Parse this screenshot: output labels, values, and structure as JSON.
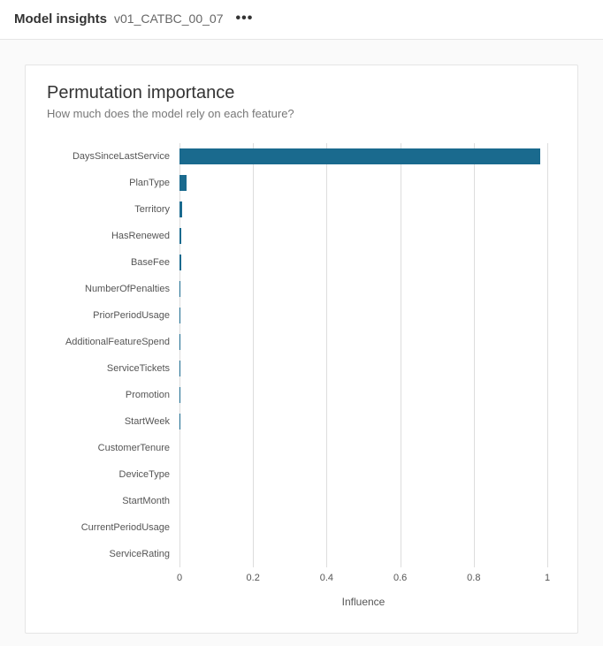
{
  "header": {
    "title": "Model insights",
    "subtitle": "v01_CATBC_00_07"
  },
  "card": {
    "title": "Permutation importance",
    "subtitle": "How much does the model rely on each feature?"
  },
  "chart_data": {
    "type": "bar",
    "orientation": "horizontal",
    "categories": [
      "DaysSinceLastService",
      "PlanType",
      "Territory",
      "HasRenewed",
      "BaseFee",
      "NumberOfPenalties",
      "PriorPeriodUsage",
      "AdditionalFeatureSpend",
      "ServiceTickets",
      "Promotion",
      "StartWeek",
      "CustomerTenure",
      "DeviceType",
      "StartMonth",
      "CurrentPeriodUsage",
      "ServiceRating"
    ],
    "values": [
      0.98,
      0.02,
      0.008,
      0.006,
      0.004,
      0.002,
      0.002,
      0.001,
      0.001,
      0.001,
      0.001,
      0.0,
      0.0,
      0.0,
      0.0,
      0.0
    ],
    "xlabel": "Influence",
    "ylabel": "",
    "xlim": [
      0,
      1
    ],
    "x_ticks": [
      0,
      0.2,
      0.4,
      0.6,
      0.8,
      1
    ],
    "x_tick_labels": [
      "0",
      "0.2",
      "0.4",
      "0.6",
      "0.8",
      "1"
    ]
  },
  "colors": {
    "bar": "#1a6a8e"
  }
}
